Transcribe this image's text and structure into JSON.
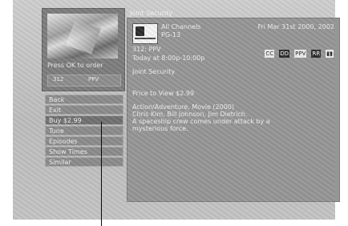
{
  "preview": {
    "prompt": "Press OK to order",
    "channel_number": "312",
    "channel_tag": "PPV"
  },
  "header": {
    "title": "Joint Security"
  },
  "info": {
    "channel_name": "All Channels",
    "rating": "PG-13",
    "datetime": "Fri Mar 31st 2000, 2002",
    "icons": [
      {
        "name": "cc-icon",
        "label": "CC"
      },
      {
        "name": "dolby-icon",
        "label": "DD"
      },
      {
        "name": "ppv-icon",
        "label": "PPV"
      },
      {
        "name": "ratings-icon",
        "label": "RR"
      },
      {
        "name": "stereo-icon",
        "label": "▮▮"
      }
    ],
    "number_line": "312: PPV",
    "time_line": "Today at 8:00p-10:00p",
    "program_title": "Joint Security",
    "price_line": "Price to View  $2.99",
    "description_lines": [
      "Action/Adventure, Movie (2000)",
      "Chris Kim, Bill Johnson, Jim Dietrich.",
      "A spaceship crew comes under attack by a",
      "mysterious force."
    ]
  },
  "menu": {
    "items": [
      "Back",
      "Exit",
      "Buy $2.99",
      "Tune",
      "Episodes",
      "Show Times",
      "Similar"
    ],
    "selected_index": 2
  }
}
